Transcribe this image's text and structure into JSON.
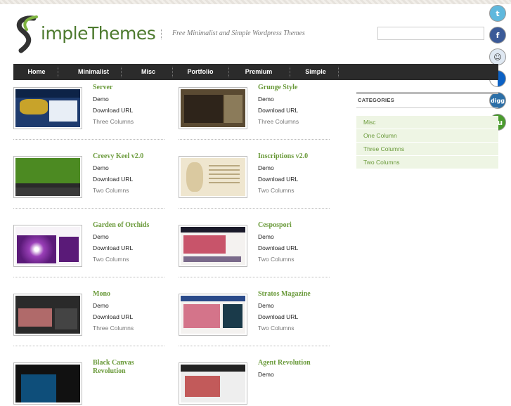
{
  "header": {
    "logo_text": "impleThemes",
    "logo_initial": "S",
    "tagline": "Free Minimalist and Simple Wordpress Themes",
    "search_placeholder": ""
  },
  "social": [
    {
      "name": "twitter-icon",
      "glyph": "t"
    },
    {
      "name": "facebook-icon",
      "glyph": "f"
    },
    {
      "name": "reddit-icon",
      "glyph": "☺"
    },
    {
      "name": "delicious-icon",
      "glyph": ""
    },
    {
      "name": "digg-icon",
      "glyph": "digg"
    },
    {
      "name": "stumbleupon-icon",
      "glyph": "su"
    }
  ],
  "nav": [
    "Home",
    "Minimalist",
    "Misc",
    "Portfolio",
    "Premium",
    "Simple"
  ],
  "themes": [
    {
      "title": "Server",
      "demo": "Demo",
      "download": "Download URL",
      "columns": "Three Columns",
      "thumb": "blue"
    },
    {
      "title": "Grunge Style",
      "demo": "Demo",
      "download": "Download URL",
      "columns": "Three Columns",
      "thumb": "grunge"
    },
    {
      "title": "Creevy Keel v2.0",
      "demo": "Demo",
      "download": "Download URL",
      "columns": "Two Columns",
      "thumb": "green"
    },
    {
      "title": "Inscriptions v2.0",
      "demo": "Demo",
      "download": "Download URL",
      "columns": "Two Columns",
      "thumb": "paper"
    },
    {
      "title": "Garden of Orchids",
      "demo": "Demo",
      "download": "Download URL",
      "columns": "Two Columns",
      "thumb": "orchid"
    },
    {
      "title": "Cespospori",
      "demo": "Demo",
      "download": "Download URL",
      "columns": "Two Columns",
      "thumb": "mag"
    },
    {
      "title": "Mono",
      "demo": "Demo",
      "download": "Download URL",
      "columns": "Three Columns",
      "thumb": "dark"
    },
    {
      "title": "Stratos Magazine",
      "demo": "Demo",
      "download": "Download URL",
      "columns": "Two Columns",
      "thumb": "mag2"
    },
    {
      "title": "Black Canvas Revolution",
      "demo": "",
      "download": "",
      "columns": "",
      "thumb": "black"
    },
    {
      "title": "Agent Revolution",
      "demo": "Demo",
      "download": "",
      "columns": "",
      "thumb": "agent"
    }
  ],
  "categories": {
    "heading": "CATEGORIES",
    "items": [
      "Misc",
      "One Column",
      "Three Columns",
      "Two Columns"
    ]
  },
  "colors": {
    "accent": "#6a9a3a",
    "nav_bg": "#2b2b2b",
    "cat_bg": "#eef5e4"
  }
}
